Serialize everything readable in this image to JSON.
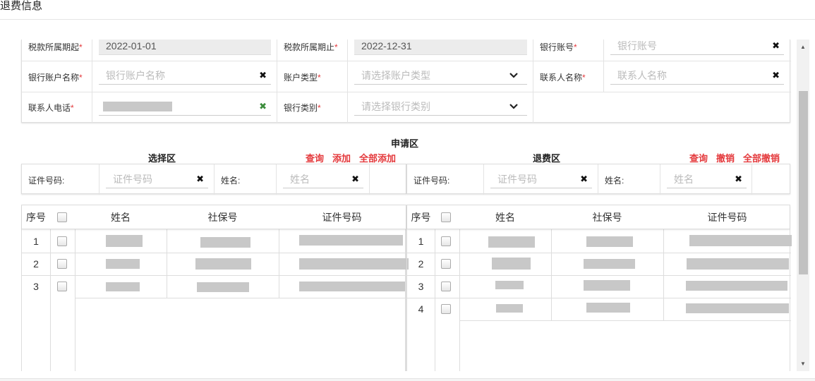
{
  "window": {
    "title": "退费信息"
  },
  "form": {
    "tax_start": {
      "label": "税款所属期起",
      "value": "2022-01-01"
    },
    "tax_end": {
      "label": "税款所属期止",
      "value": "2022-12-31"
    },
    "bank_account": {
      "label": "银行账号",
      "placeholder": "银行账号"
    },
    "bank_account_name": {
      "label": "银行账户名称",
      "placeholder": "银行账户名称"
    },
    "account_type": {
      "label": "账户类型",
      "placeholder": "请选择账户类型"
    },
    "contact_name": {
      "label": "联系人名称",
      "placeholder": "联系人名称"
    },
    "contact_phone": {
      "label": "联系人电话"
    },
    "bank_type": {
      "label": "银行类别",
      "placeholder": "请选择银行类别"
    },
    "required_mark": "*"
  },
  "apply_area": {
    "title": "申请区"
  },
  "select_area": {
    "title": "选择区",
    "actions": [
      "查询",
      "添加",
      "全部添加"
    ],
    "id_label": "证件号码:",
    "id_placeholder": "证件号码",
    "name_label": "姓名:",
    "name_placeholder": "姓名",
    "columns": [
      "序号",
      "姓名",
      "社保号",
      "证件号码"
    ],
    "rows": [
      {
        "no": "1"
      },
      {
        "no": "2"
      },
      {
        "no": "3"
      }
    ]
  },
  "refund_area": {
    "title": "退费区",
    "actions": [
      "查询",
      "撤销",
      "全部撤销"
    ],
    "id_label": "证件号码:",
    "id_placeholder": "证件号码",
    "name_label": "姓名:",
    "name_placeholder": "姓名",
    "columns": [
      "序号",
      "姓名",
      "社保号",
      "证件号码"
    ],
    "rows": [
      {
        "no": "1"
      },
      {
        "no": "2"
      },
      {
        "no": "3"
      },
      {
        "no": "4"
      }
    ]
  },
  "icons": {
    "clear": "✖",
    "dropdown": "chevron-down-icon",
    "scroll_up": "▲",
    "scroll_down": "▼"
  },
  "colors": {
    "required": "#e4393c",
    "action": "#e4393c",
    "valid": "#3c8d3c"
  }
}
